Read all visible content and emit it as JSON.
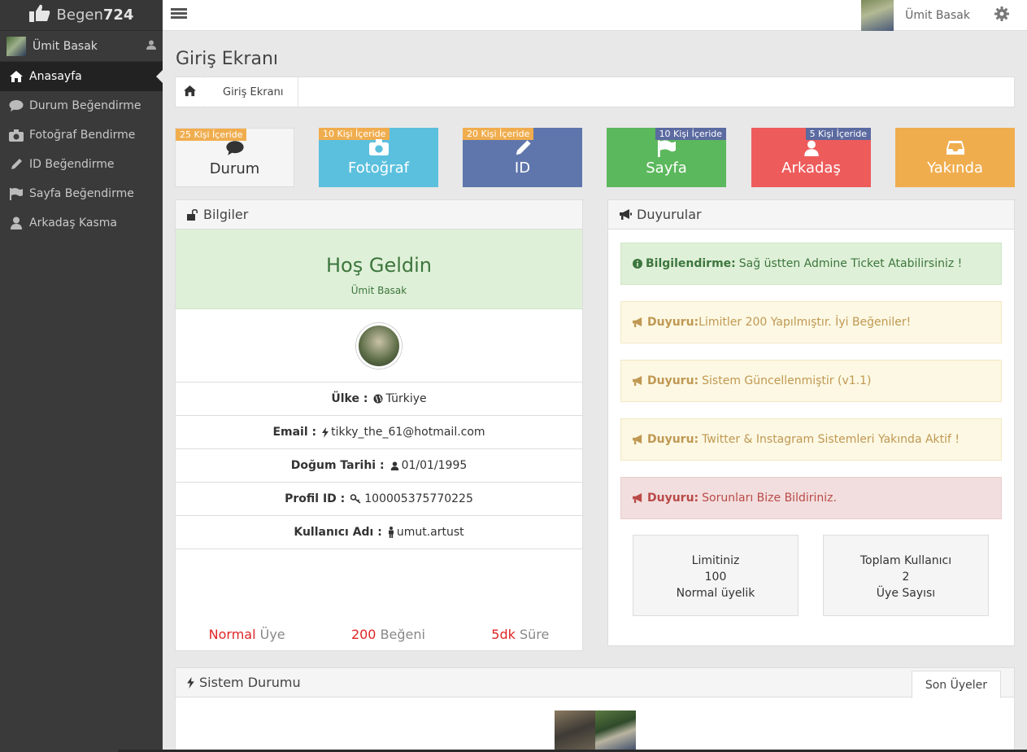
{
  "brand": {
    "name_light": "Begen",
    "name_bold": "724"
  },
  "user": {
    "name": "Ümit Basak"
  },
  "sidebar": {
    "items": [
      {
        "label": "Anasayfa",
        "icon": "home-icon"
      },
      {
        "label": "Durum Beğendirme",
        "icon": "comment-icon"
      },
      {
        "label": "Fotoğraf Bendirme",
        "icon": "camera-icon"
      },
      {
        "label": "ID Beğendirme",
        "icon": "pencil-icon"
      },
      {
        "label": "Sayfa Beğendirme",
        "icon": "flag-icon"
      },
      {
        "label": "Arkadaş Kasma",
        "icon": "user-icon"
      }
    ]
  },
  "page": {
    "title": "Giriş Ekranı"
  },
  "breadcrumb": {
    "current": "Giriş Ekranı"
  },
  "tiles": [
    {
      "label": "Durum",
      "badge": "25 Kişi İçeride",
      "color": "#f5f5f5"
    },
    {
      "label": "Fotoğraf",
      "badge": "10 Kişi İçeride",
      "color": "#5bc0de"
    },
    {
      "label": "ID",
      "badge": "20 Kişi İçeride",
      "color": "#5f76ac"
    },
    {
      "label": "Sayfa",
      "badge": "10 Kişi İçeride",
      "color": "#5cb85c"
    },
    {
      "label": "Arkadaş",
      "badge": "5 Kişi İçeride",
      "color": "#ee5b5b"
    },
    {
      "label": "Yakında",
      "badge": "",
      "color": "#f0ad4e"
    }
  ],
  "info": {
    "heading": "Bilgiler",
    "welcome": "Hoş Geldin",
    "name": "Ümit Basak",
    "rows": [
      {
        "label": "Ülke :",
        "value": "Türkiye"
      },
      {
        "label": "Email :",
        "value": "tikky_the_61@hotmail.com"
      },
      {
        "label": "Doğum Tarihi :",
        "value": "01/01/1995"
      },
      {
        "label": "Profil ID :",
        "value": "100005375770225"
      },
      {
        "label": "Kullanıcı Adı :",
        "value": "umut.artust"
      }
    ],
    "stats": [
      {
        "highlight": "Normal",
        "label": "Üye"
      },
      {
        "highlight": "200",
        "label": "Beğeni"
      },
      {
        "highlight": "5dk",
        "label": "Süre"
      }
    ]
  },
  "announcements": {
    "heading": "Duyurular",
    "items": [
      {
        "title": "Bilgilendirme:",
        "text": "Sağ üstten Admine Ticket Atabilirsiniz !",
        "type": "green"
      },
      {
        "title": "Duyuru:",
        "text": "Limitler 200 Yapılmıştır. İyi Beğeniler!",
        "type": "yellow"
      },
      {
        "title": "Duyuru:",
        "text": "Sistem Güncellenmiştir (v1.1)",
        "type": "yellow"
      },
      {
        "title": "Duyuru:",
        "text": "Twitter & Instagram Sistemleri Yakında Aktif !",
        "type": "yellow"
      },
      {
        "title": "Duyuru:",
        "text": "Sorunları Bize Bildiriniz.",
        "type": "red"
      }
    ],
    "wells": [
      {
        "line1": "Limitiniz",
        "line2": "100",
        "line3": "Normal üyelik"
      },
      {
        "line1": "Toplam Kullanıcı",
        "line2": "2",
        "line3": "Üye Sayısı"
      }
    ]
  },
  "system": {
    "heading": "Sistem Durumu",
    "tab": "Son Üyeler"
  }
}
